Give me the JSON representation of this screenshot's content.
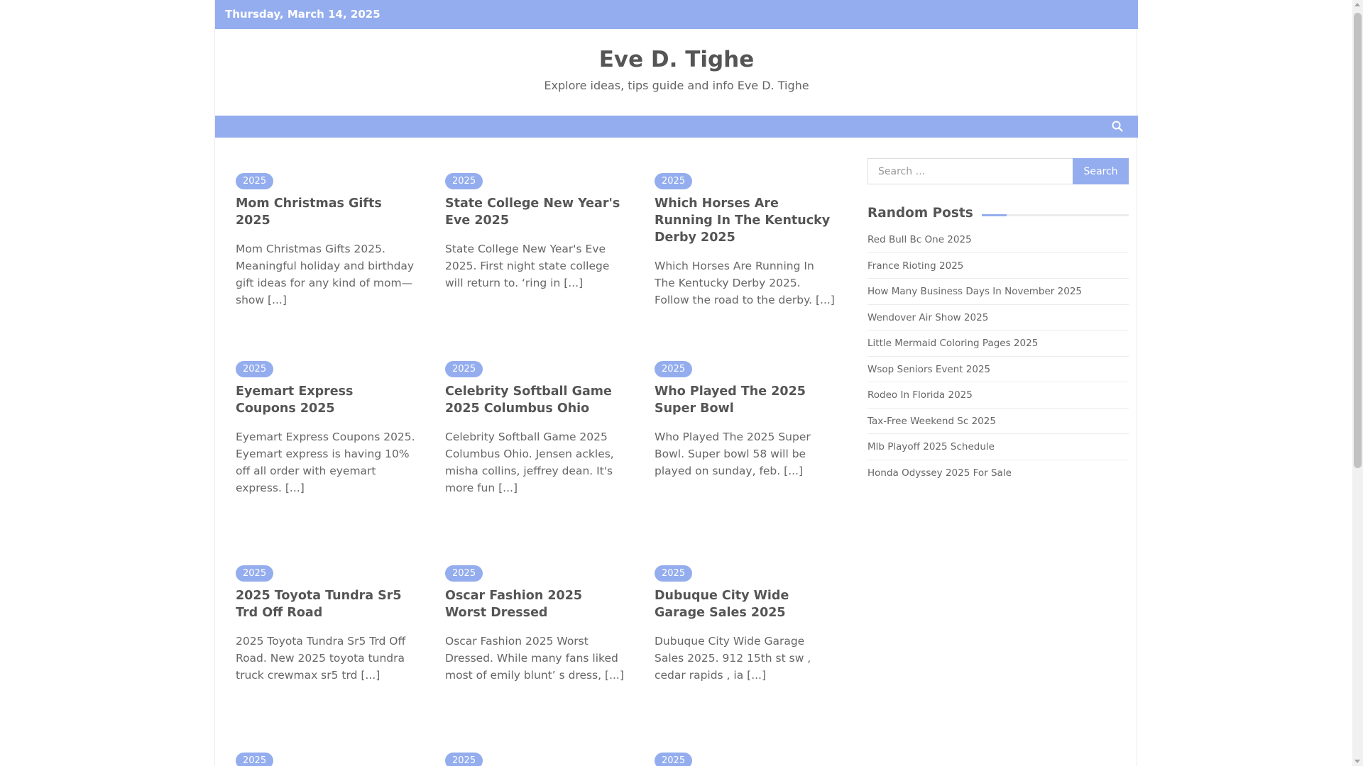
{
  "topbar": {
    "date": "Thursday, March 14, 2025"
  },
  "header": {
    "site_title": "Eve D. Tighe",
    "tagline": "Explore ideas, tips guide and info Eve D. Tighe"
  },
  "icons": {
    "nav_search": "search-icon"
  },
  "colors": {
    "accent": "#94adee"
  },
  "posts": [
    {
      "badge": "2025",
      "title": "Mom Christmas Gifts 2025",
      "excerpt": "Mom Christmas Gifts 2025. Meaningful holiday and birthday gift ideas for any kind of mom—show",
      "more": "[...]"
    },
    {
      "badge": "2025",
      "title": "State College New Year's Eve 2025",
      "excerpt": "State College New Year's Eve 2025. First night state college will return to. ‘ring in",
      "more": "[...]"
    },
    {
      "badge": "2025",
      "title": "Which Horses Are Running In The Kentucky Derby 2025",
      "excerpt": "Which Horses Are Running In The Kentucky Derby 2025. Follow the road to the derby.",
      "more": "[...]"
    },
    {
      "badge": "2025",
      "title": "Eyemart Express Coupons 2025",
      "excerpt": "Eyemart Express Coupons 2025. Eyemart express is having 10% off all order with eyemart express.",
      "more": "[...]"
    },
    {
      "badge": "2025",
      "title": "Celebrity Softball Game 2025 Columbus Ohio",
      "excerpt": "Celebrity Softball Game 2025 Columbus Ohio. Jensen ackles, misha collins, jeffrey dean. It's more fun",
      "more": "[...]"
    },
    {
      "badge": "2025",
      "title": "Who Played The 2025 Super Bowl",
      "excerpt": "Who Played The 2025 Super Bowl. Super bowl 58 will be played on sunday, feb.",
      "more": "[...]"
    },
    {
      "badge": "2025",
      "title": "2025 Toyota Tundra Sr5 Trd Off Road",
      "excerpt": "2025 Toyota Tundra Sr5 Trd Off Road. New 2025 toyota tundra truck crewmax sr5 trd",
      "more": "[...]"
    },
    {
      "badge": "2025",
      "title": "Oscar Fashion 2025 Worst Dressed",
      "excerpt": "Oscar Fashion 2025 Worst Dressed. While many fans liked most of emily blunt’ s dress,",
      "more": "[...]"
    },
    {
      "badge": "2025",
      "title": "Dubuque City Wide Garage Sales 2025",
      "excerpt": "Dubuque City Wide Garage Sales 2025. 912 15th st sw , cedar rapids , ia",
      "more": "[...]"
    },
    {
      "badge": "2025"
    },
    {
      "badge": "2025"
    },
    {
      "badge": "2025"
    }
  ],
  "sidebar": {
    "search_placeholder": "Search …",
    "search_button": "Search",
    "random_posts_title": "Random Posts",
    "random_posts": [
      "Red Bull Bc One 2025",
      "France Rioting 2025",
      "How Many Business Days In November 2025",
      "Wendover Air Show 2025",
      "Little Mermaid Coloring Pages 2025",
      "Wsop Seniors Event 2025",
      "Rodeo In Florida 2025",
      "Tax-Free Weekend Sc 2025",
      "Mlb Playoff 2025 Schedule",
      "Honda Odyssey 2025 For Sale"
    ]
  }
}
